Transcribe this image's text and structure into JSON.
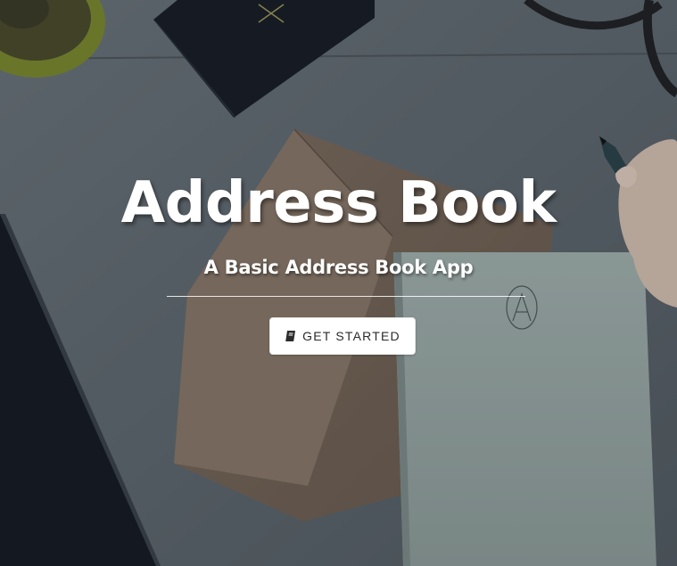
{
  "hero": {
    "title": "Address Book",
    "subtitle": "A Basic Address Book App",
    "cta_label": "GET STARTED",
    "cta_icon": "book-icon"
  },
  "colors": {
    "text": "#ffffff",
    "button_bg": "#ffffff",
    "button_text": "#2b2b2b",
    "desk": "#5f6971"
  }
}
